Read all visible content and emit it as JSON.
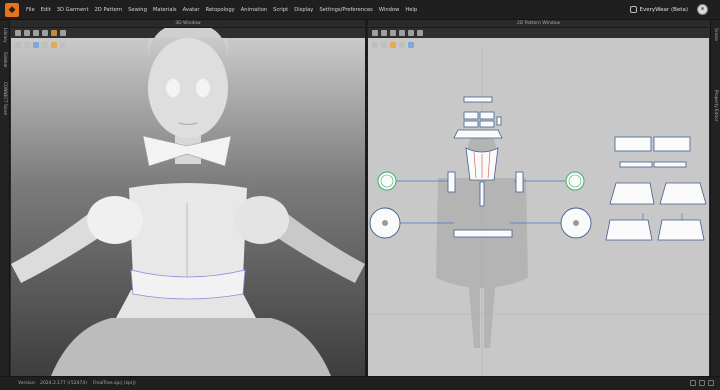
{
  "menu": {
    "items": [
      "File",
      "Edit",
      "3D Garment",
      "2D Pattern",
      "Sewing",
      "Materials",
      "Avatar",
      "Retopology",
      "Animation",
      "Script",
      "Display",
      "Settings/Preferences",
      "Window",
      "Help"
    ],
    "brand": "EveryWear (Beta)"
  },
  "left_tabs": [
    "Library",
    "Sidebar",
    "CONNECT Store"
  ],
  "right_tabs": [
    "Scene",
    "Property Editor"
  ],
  "panels": {
    "view3d_title": "3D Window",
    "view2d_title": "2D Pattern Window"
  },
  "status": {
    "version_label": "Version:",
    "version_value": "2024.2.177 (r52474)",
    "file_name": "FinalTree.zprj (zprj)"
  },
  "colors": {
    "accent": "#e8731a",
    "pattern_outline": "#3f5f8f",
    "sewing_line": "#4a77c9",
    "seam_red": "#d05050",
    "selection_green": "#3fae6b"
  }
}
